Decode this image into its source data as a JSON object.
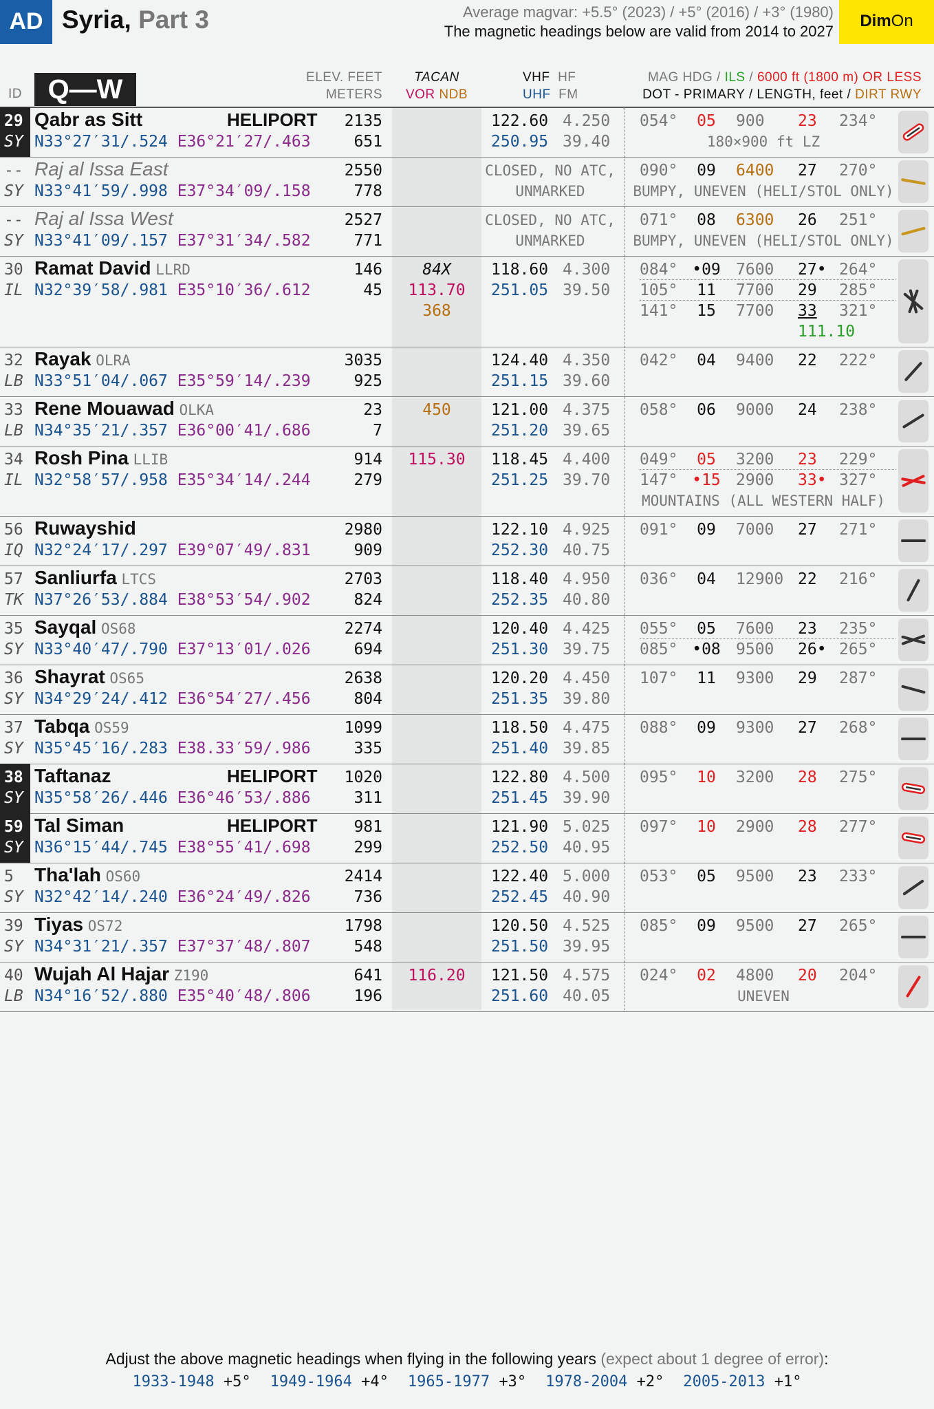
{
  "header": {
    "ad": "AD",
    "title": "Syria,",
    "part": " Part 3",
    "magvar_line1": "Average magvar: +5.5° (2023) / +5° (2016) /  +3° (1980)",
    "magvar_line2": "The magnetic headings below are valid from 2014 to 2027",
    "dim": "Dim",
    "on": "On"
  },
  "cols": {
    "id": "ID",
    "section": "Q—W",
    "elev1": "ELEV. FEET",
    "elev2": "METERS",
    "tacan": "TACAN",
    "vor": "VOR",
    "ndb": "NDB",
    "vhf": "VHF",
    "hf": "HF",
    "uhf": "UHF",
    "fm": "FM",
    "mag1a": "MAG HDG / ",
    "mag1b": "ILS",
    "mag1c": " / ",
    "mag1d": "6000 ft (1800 m) OR LESS",
    "mag2a": "DOT - PRIMARY / LENGTH, feet / ",
    "mag2b": "DIRT RWY"
  },
  "rows": [
    {
      "id": "29",
      "cc": "SY",
      "hl": true,
      "name": "Qabr as Sitt",
      "code": "",
      "tag": "HELIPORT",
      "lat": "N33°27′31/.524",
      "lon": "E36°21′27/.463",
      "elev_ft": "2135",
      "elev_m": "651",
      "vhf": "122.60",
      "hf": "4.250",
      "uhf": "250.95",
      "fm": "39.40",
      "rwys": [
        {
          "h1": "054°",
          "r1": "05",
          "r1c": "red",
          "len": "900",
          "r2": "23",
          "r2c": "red",
          "h2": "234°"
        }
      ],
      "note": "180×900 ft LZ"
    },
    {
      "id": "--",
      "cc": "SY",
      "closed": true,
      "name": "Raj al Issa East",
      "code": "",
      "tag": "",
      "lat": "N33°41′59/.998",
      "lon": "E37°34′09/.158",
      "elev_ft": "2550",
      "elev_m": "778",
      "status1": "CLOSED, NO ATC,",
      "status2": "UNMARKED",
      "rwys": [
        {
          "h1": "090°",
          "r1": "09",
          "len": "6400",
          "lenc": "org",
          "r2": "27",
          "h2": "270°"
        }
      ],
      "note": "BUMPY, UNEVEN (HELI/STOL ONLY)"
    },
    {
      "id": "--",
      "cc": "SY",
      "closed": true,
      "name": "Raj al Issa West",
      "code": "",
      "tag": "",
      "lat": "N33°41′09/.157",
      "lon": "E37°31′34/.582",
      "elev_ft": "2527",
      "elev_m": "771",
      "status1": "CLOSED, NO ATC,",
      "status2": "UNMARKED",
      "rwys": [
        {
          "h1": "071°",
          "r1": "08",
          "len": "6300",
          "lenc": "org",
          "r2": "26",
          "h2": "251°"
        }
      ],
      "note": "BUMPY, UNEVEN (HELI/STOL ONLY)"
    },
    {
      "id": "30",
      "cc": "IL",
      "name": "Ramat David",
      "code": "LLRD",
      "tag": "",
      "lat": "N32°39′58/.981",
      "lon": "E35°10′36/.612",
      "elev_ft": "146",
      "elev_m": "45",
      "tacan": "84X",
      "vor": "113.70",
      "ndb": "368",
      "vhf": "118.60",
      "hf": "4.300",
      "uhf": "251.05",
      "fm": "39.50",
      "rwys": [
        {
          "h1": "084°",
          "r1": "•09",
          "len": "7600",
          "r2": "27•",
          "h2": "264°"
        },
        {
          "h1": "105°",
          "r1": "11",
          "len": "7700",
          "r2": "29",
          "h2": "285°"
        },
        {
          "h1": "141°",
          "r1": "15",
          "len": "7700",
          "r2": "33",
          "h2": "321°",
          "ils": "111.10"
        }
      ]
    },
    {
      "id": "32",
      "cc": "LB",
      "name": "Rayak",
      "code": "OLRA",
      "tag": "",
      "lat": "N33°51′04/.067",
      "lon": "E35°59′14/.239",
      "elev_ft": "3035",
      "elev_m": "925",
      "vhf": "124.40",
      "hf": "4.350",
      "uhf": "251.15",
      "fm": "39.60",
      "rwys": [
        {
          "h1": "042°",
          "r1": "04",
          "len": "9400",
          "r2": "22",
          "h2": "222°"
        }
      ]
    },
    {
      "id": "33",
      "cc": "LB",
      "name": "Rene Mouawad",
      "code": "OLKA",
      "tag": "",
      "lat": "N34°35′21/.357",
      "lon": "E36°00′41/.686",
      "elev_ft": "23",
      "elev_m": "7",
      "ndb": "450",
      "vhf": "121.00",
      "hf": "4.375",
      "uhf": "251.20",
      "fm": "39.65",
      "rwys": [
        {
          "h1": "058°",
          "r1": "06",
          "len": "9000",
          "r2": "24",
          "h2": "238°"
        }
      ]
    },
    {
      "id": "34",
      "cc": "IL",
      "name": "Rosh Pina",
      "code": "LLIB",
      "tag": "",
      "lat": "N32°58′57/.958",
      "lon": "E35°34′14/.244",
      "elev_ft": "914",
      "elev_m": "279",
      "vor": "115.30",
      "vhf": "118.45",
      "hf": "4.400",
      "uhf": "251.25",
      "fm": "39.70",
      "rwys": [
        {
          "h1": "049°",
          "r1": "05",
          "r1c": "red",
          "len": "3200",
          "r2": "23",
          "r2c": "red",
          "h2": "229°"
        },
        {
          "h1": "147°",
          "r1": "•15",
          "r1c": "red",
          "len": "2900",
          "r2": "33•",
          "r2c": "red",
          "h2": "327°"
        }
      ],
      "note": "MOUNTAINS (ALL WESTERN HALF)"
    },
    {
      "id": "56",
      "cc": "IQ",
      "name": "Ruwayshid",
      "code": "",
      "tag": "",
      "lat": "N32°24′17/.297",
      "lon": "E39°07′49/.831",
      "elev_ft": "2980",
      "elev_m": "909",
      "vhf": "122.10",
      "hf": "4.925",
      "uhf": "252.30",
      "fm": "40.75",
      "rwys": [
        {
          "h1": "091°",
          "r1": "09",
          "len": "7000",
          "r2": "27",
          "h2": "271°"
        }
      ]
    },
    {
      "id": "57",
      "cc": "TK",
      "name": "Sanliurfa",
      "code": "LTCS",
      "tag": "",
      "lat": "N37°26′53/.884",
      "lon": "E38°53′54/.902",
      "elev_ft": "2703",
      "elev_m": "824",
      "vhf": "118.40",
      "hf": "4.950",
      "uhf": "252.35",
      "fm": "40.80",
      "rwys": [
        {
          "h1": "036°",
          "r1": "04",
          "len": "12900",
          "r2": "22",
          "h2": "216°"
        }
      ]
    },
    {
      "id": "35",
      "cc": "SY",
      "name": "Sayqal",
      "code": "OS68",
      "tag": "",
      "lat": "N33°40′47/.790",
      "lon": "E37°13′01/.026",
      "elev_ft": "2274",
      "elev_m": "694",
      "vhf": "120.40",
      "hf": "4.425",
      "uhf": "251.30",
      "fm": "39.75",
      "rwys": [
        {
          "h1": "055°",
          "r1": "05",
          "len": "7600",
          "r2": "23",
          "h2": "235°"
        },
        {
          "h1": "085°",
          "r1": "•08",
          "len": "9500",
          "r2": "26•",
          "h2": "265°"
        }
      ]
    },
    {
      "id": "36",
      "cc": "SY",
      "name": "Shayrat",
      "code": "OS65",
      "tag": "",
      "lat": "N34°29′24/.412",
      "lon": "E36°54′27/.456",
      "elev_ft": "2638",
      "elev_m": "804",
      "vhf": "120.20",
      "hf": "4.450",
      "uhf": "251.35",
      "fm": "39.80",
      "rwys": [
        {
          "h1": "107°",
          "r1": "11",
          "len": "9300",
          "r2": "29",
          "h2": "287°"
        }
      ]
    },
    {
      "id": "37",
      "cc": "SY",
      "name": "Tabqa",
      "code": "OS59",
      "tag": "",
      "lat": "N35°45′16/.283",
      "lon": "E38.33′59/.986",
      "elev_ft": "1099",
      "elev_m": "335",
      "vhf": "118.50",
      "hf": "4.475",
      "uhf": "251.40",
      "fm": "39.85",
      "rwys": [
        {
          "h1": "088°",
          "r1": "09",
          "len": "9300",
          "r2": "27",
          "h2": "268°"
        }
      ]
    },
    {
      "id": "38",
      "cc": "SY",
      "hl": true,
      "name": "Taftanaz",
      "code": "",
      "tag": "HELIPORT",
      "lat": "N35°58′26/.446",
      "lon": "E36°46′53/.886",
      "elev_ft": "1020",
      "elev_m": "311",
      "vhf": "122.80",
      "hf": "4.500",
      "uhf": "251.45",
      "fm": "39.90",
      "rwys": [
        {
          "h1": "095°",
          "r1": "10",
          "r1c": "red",
          "len": "3200",
          "r2": "28",
          "r2c": "red",
          "h2": "275°"
        }
      ]
    },
    {
      "id": "59",
      "cc": "SY",
      "hl": true,
      "name": "Tal Siman",
      "code": "",
      "tag": "HELIPORT",
      "lat": "N36°15′44/.745",
      "lon": "E38°55′41/.698",
      "elev_ft": "981",
      "elev_m": "299",
      "vhf": "121.90",
      "hf": "5.025",
      "uhf": "252.50",
      "fm": "40.95",
      "rwys": [
        {
          "h1": "097°",
          "r1": "10",
          "r1c": "red",
          "len": "2900",
          "r2": "28",
          "r2c": "red",
          "h2": "277°"
        }
      ]
    },
    {
      "id": "5",
      "cc": "SY",
      "name": "Tha'lah",
      "code": "OS60",
      "tag": "",
      "lat": "N32°42′14/.240",
      "lon": "E36°24′49/.826",
      "elev_ft": "2414",
      "elev_m": "736",
      "vhf": "122.40",
      "hf": "5.000",
      "uhf": "252.45",
      "fm": "40.90",
      "rwys": [
        {
          "h1": "053°",
          "r1": "05",
          "len": "9500",
          "r2": "23",
          "h2": "233°"
        }
      ]
    },
    {
      "id": "39",
      "cc": "SY",
      "name": "Tiyas",
      "code": "OS72",
      "tag": "",
      "lat": "N34°31′21/.357",
      "lon": "E37°37′48/.807",
      "elev_ft": "1798",
      "elev_m": "548",
      "vhf": "120.50",
      "hf": "4.525",
      "uhf": "251.50",
      "fm": "39.95",
      "rwys": [
        {
          "h1": "085°",
          "r1": "09",
          "len": "9500",
          "r2": "27",
          "h2": "265°"
        }
      ]
    },
    {
      "id": "40",
      "cc": "LB",
      "name": "Wujah Al Hajar",
      "code": "Z190",
      "tag": "",
      "lat": "N34°16′52/.880",
      "lon": "E35°40′48/.806",
      "elev_ft": "641",
      "elev_m": "196",
      "vor": "116.20",
      "vhf": "121.50",
      "hf": "4.575",
      "uhf": "251.60",
      "fm": "40.05",
      "rwys": [
        {
          "h1": "024°",
          "r1": "02",
          "r1c": "red",
          "len": "4800",
          "r2": "20",
          "r2c": "red",
          "h2": "204°"
        }
      ],
      "note": "UNEVEN"
    }
  ],
  "footer": {
    "line1a": "Adjust the above magnetic headings when flying in the following years",
    "line1b": " (expect about 1 degree of error)",
    "line1c": ":",
    "years": [
      {
        "range": "1933-1948",
        "adj": "+5°"
      },
      {
        "range": "1949-1964",
        "adj": "+4°"
      },
      {
        "range": "1965-1977",
        "adj": "+3°"
      },
      {
        "range": "1978-2004",
        "adj": "+2°"
      },
      {
        "range": "2005-2013",
        "adj": "+1°"
      }
    ]
  },
  "colors": {
    "ad_blue": "#1a5ea8",
    "dim_yellow": "#ffe400",
    "coord_blue": "#1a5490",
    "vor_magenta": "#c01060",
    "ndb_orange": "#b86f10",
    "ils_green": "#28a028",
    "short_red": "#e02020"
  }
}
